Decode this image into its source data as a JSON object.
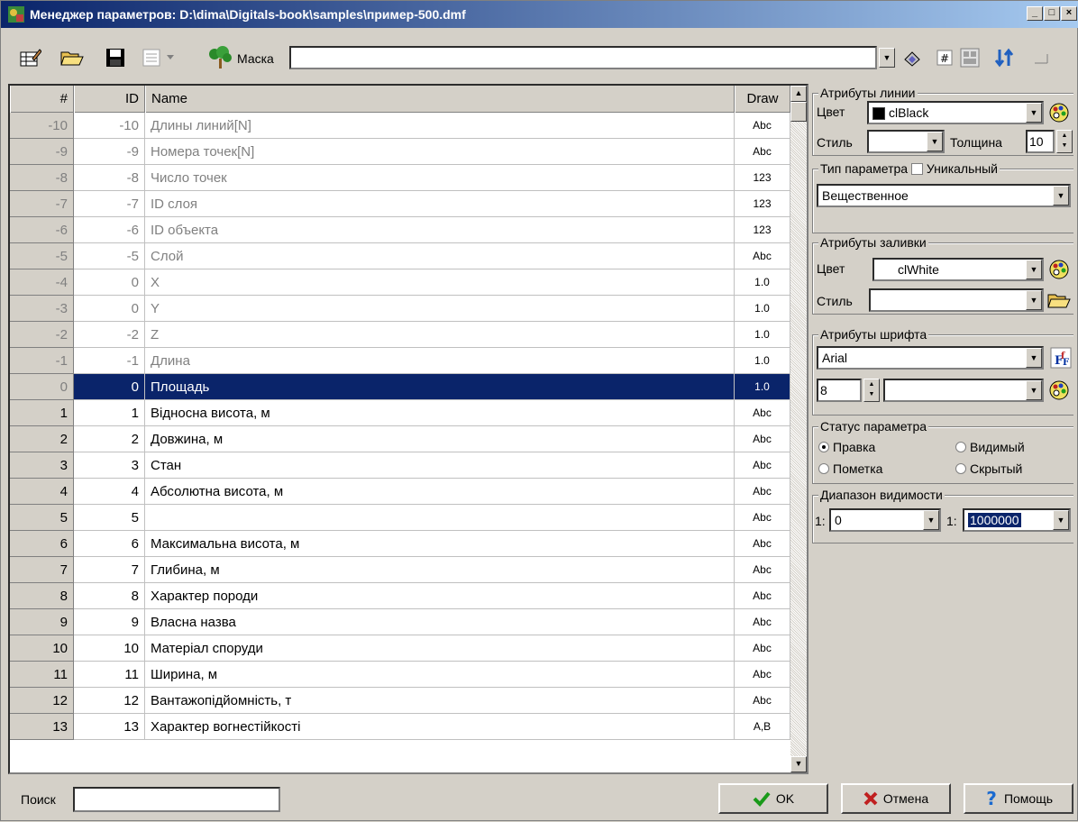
{
  "window": {
    "title": "Менеджер параметров: D:\\dima\\Digitals-book\\samples\\пример-500.dmf",
    "btn_min": "_",
    "btn_max": "□",
    "btn_close": "×"
  },
  "toolbar": {
    "mask_label": "Маска",
    "mask_value": ""
  },
  "grid": {
    "headers": [
      "#",
      "ID",
      "Name",
      "Draw"
    ],
    "rows": [
      {
        "num": "-10",
        "id": "-10",
        "name": "Длины линий[N]",
        "draw": "Abc"
      },
      {
        "num": "-9",
        "id": "-9",
        "name": "Номера точек[N]",
        "draw": "Abc"
      },
      {
        "num": "-8",
        "id": "-8",
        "name": "Число точек",
        "draw": "123"
      },
      {
        "num": "-7",
        "id": "-7",
        "name": "ID слоя",
        "draw": "123"
      },
      {
        "num": "-6",
        "id": "-6",
        "name": "ID объекта",
        "draw": "123"
      },
      {
        "num": "-5",
        "id": "-5",
        "name": "Слой",
        "draw": "Abc"
      },
      {
        "num": "-4",
        "id": "0",
        "name": "X",
        "draw": "1.0"
      },
      {
        "num": "-3",
        "id": "0",
        "name": "Y",
        "draw": "1.0"
      },
      {
        "num": "-2",
        "id": "-2",
        "name": "Z",
        "draw": "1.0"
      },
      {
        "num": "-1",
        "id": "-1",
        "name": "Длина",
        "draw": "1.0"
      },
      {
        "num": "0",
        "id": "0",
        "name": "Площадь",
        "draw": "1.0"
      },
      {
        "num": "1",
        "id": "1",
        "name": "Відносна висота, м",
        "draw": "Abc"
      },
      {
        "num": "2",
        "id": "2",
        "name": "Довжина, м",
        "draw": "Abc"
      },
      {
        "num": "3",
        "id": "3",
        "name": "Стан",
        "draw": "Abc"
      },
      {
        "num": "4",
        "id": "4",
        "name": "Абсолютна висота, м",
        "draw": "Abc"
      },
      {
        "num": "5",
        "id": "5",
        "name": "",
        "draw": "Abc"
      },
      {
        "num": "6",
        "id": "6",
        "name": "Максимальна висота, м",
        "draw": "Abc"
      },
      {
        "num": "7",
        "id": "7",
        "name": "Глибина, м",
        "draw": "Abc"
      },
      {
        "num": "8",
        "id": "8",
        "name": "Характер породи",
        "draw": "Abc"
      },
      {
        "num": "9",
        "id": "9",
        "name": "Власна назва",
        "draw": "Abc"
      },
      {
        "num": "10",
        "id": "10",
        "name": "Матеріал споруди",
        "draw": "Abc"
      },
      {
        "num": "11",
        "id": "11",
        "name": "Ширина, м",
        "draw": "Abc"
      },
      {
        "num": "12",
        "id": "12",
        "name": "Вантажопідйомність, т",
        "draw": "Abc"
      },
      {
        "num": "13",
        "id": "13",
        "name": "Характер вогнестійкості",
        "draw": "A,B"
      }
    ]
  },
  "line_attrs": {
    "title": "Атрибуты линии",
    "color_label": "Цвет",
    "color_value": "clBlack",
    "color_hex": "#000000",
    "style_label": "Стиль",
    "style_value": "",
    "width_label": "Толщина",
    "width_value": "10"
  },
  "param_type": {
    "title": "Тип параметра",
    "unique_label": "Уникальный",
    "value": "Вещественное"
  },
  "fill_attrs": {
    "title": "Атрибуты заливки",
    "color_label": "Цвет",
    "color_value": "clWhite",
    "style_label": "Стиль",
    "style_value": ""
  },
  "font_attrs": {
    "title": "Атрибуты шрифта",
    "font_value": "Arial",
    "size_value": "8",
    "style_value": ""
  },
  "status": {
    "title": "Статус параметра",
    "edit": "Правка",
    "visible": "Видимый",
    "mark": "Пометка",
    "hidden": "Скрытый"
  },
  "visibility": {
    "title": "Диапазон видимости",
    "prefix1": "1:",
    "from_value": "0",
    "prefix2": "1:",
    "to_value": "1000000"
  },
  "bottom": {
    "search_label": "Поиск",
    "search_value": "",
    "ok_label": "OK",
    "cancel_label": "Отмена",
    "help_label": "Помощь"
  }
}
